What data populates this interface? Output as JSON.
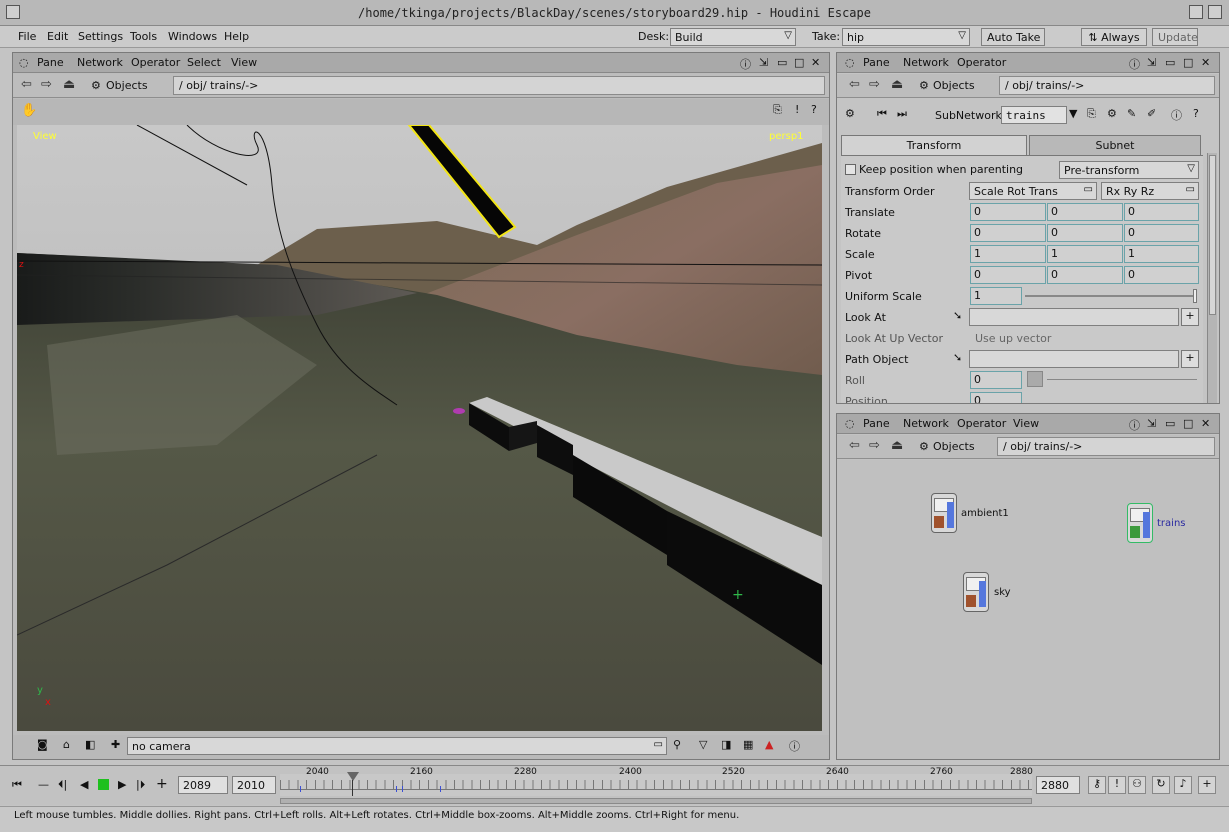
{
  "window": {
    "title": "/home/tkinga/projects/BlackDay/scenes/storyboard29.hip - Houdini Escape"
  },
  "menubar": {
    "items": [
      "File",
      "Edit",
      "Settings",
      "Tools",
      "Windows",
      "Help"
    ],
    "desk_label": "Desk:",
    "desk_value": "Build",
    "take_label": "Take:",
    "take_value": "hip",
    "auto_take": "Auto Take",
    "always": "Always",
    "update": "Update"
  },
  "viewer": {
    "menu": [
      "Pane",
      "Network",
      "Operator",
      "Select",
      "View"
    ],
    "context": "Objects",
    "path": "/ obj/ trains/->",
    "view_label": "View",
    "camera_label": "persp1",
    "camera_menu": "no camera",
    "axis_y": "y",
    "axis_x": "x"
  },
  "params": {
    "menu": [
      "Pane",
      "Network",
      "Operator"
    ],
    "context": "Objects",
    "path": "/ obj/ trains/->",
    "subnetwork_label": "SubNetwork",
    "subnetwork_value": "trains",
    "tabs": [
      "Transform",
      "Subnet"
    ],
    "keep_position": "Keep position when parenting",
    "pre_transform": "Pre-transform",
    "transform_order_label": "Transform Order",
    "transform_order_value": "Scale Rot Trans",
    "rotate_order_value": "Rx Ry Rz",
    "rows": [
      {
        "label": "Translate",
        "values": [
          "0",
          "0",
          "0"
        ]
      },
      {
        "label": "Rotate",
        "values": [
          "0",
          "0",
          "0"
        ]
      },
      {
        "label": "Scale",
        "values": [
          "1",
          "1",
          "1"
        ]
      },
      {
        "label": "Pivot",
        "values": [
          "0",
          "0",
          "0"
        ]
      }
    ],
    "uniform_scale_label": "Uniform Scale",
    "uniform_scale_value": "1",
    "look_at_label": "Look At",
    "look_at_up_label": "Look At Up Vector",
    "look_at_up_value": "Use up vector",
    "path_object_label": "Path Object",
    "roll_label": "Roll",
    "roll_value": "0",
    "position_label": "Position",
    "position_value": "0"
  },
  "network": {
    "menu": [
      "Pane",
      "Network",
      "Operator",
      "View"
    ],
    "context": "Objects",
    "path": "/ obj/ trains/->",
    "nodes": [
      {
        "name": "ambient1"
      },
      {
        "name": "trains"
      },
      {
        "name": "sky"
      }
    ]
  },
  "timeline": {
    "current_frame": "2089",
    "start_frame": "2010",
    "end_frame": "2880",
    "ticks": [
      "2040",
      "2160",
      "2280",
      "2400",
      "2520",
      "2640",
      "2760",
      "2880"
    ]
  },
  "status": {
    "text": "Left mouse tumbles. Middle dollies. Right pans. Ctrl+Left rolls. Alt+Left rotates. Ctrl+Middle box-zooms. Alt+Middle zooms. Ctrl+Right for menu."
  },
  "colors": {
    "viewport_label": "#ffff33",
    "node_selected_label": "#2a2aa0",
    "param_field_border": "#6aa3a9"
  }
}
